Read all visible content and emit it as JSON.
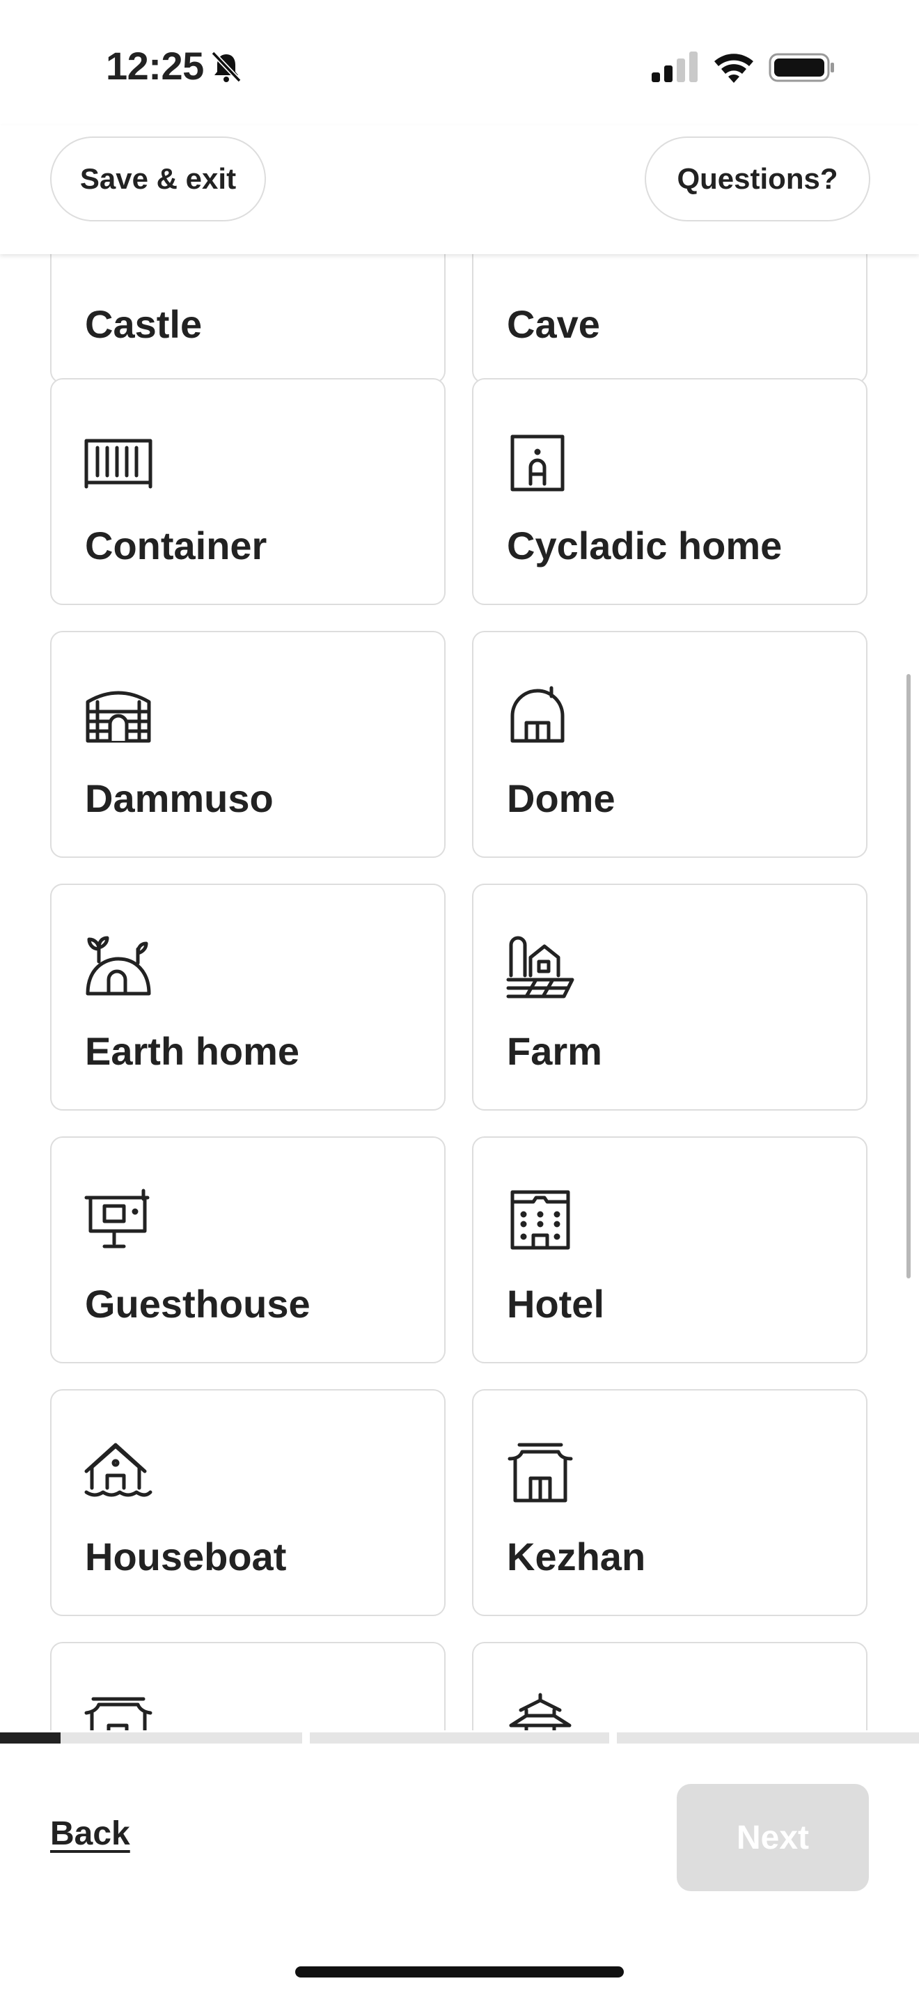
{
  "status_bar": {
    "time": "12:25"
  },
  "header": {
    "save_exit_label": "Save & exit",
    "questions_label": "Questions?"
  },
  "tiles": [
    {
      "label": "Castle",
      "icon": "castle-icon"
    },
    {
      "label": "Cave",
      "icon": "cave-icon"
    },
    {
      "label": "Container",
      "icon": "container-icon"
    },
    {
      "label": "Cycladic home",
      "icon": "cycladic-home-icon"
    },
    {
      "label": "Dammuso",
      "icon": "dammuso-icon"
    },
    {
      "label": "Dome",
      "icon": "dome-icon"
    },
    {
      "label": "Earth home",
      "icon": "earth-home-icon"
    },
    {
      "label": "Farm",
      "icon": "farm-icon"
    },
    {
      "label": "Guesthouse",
      "icon": "guesthouse-icon"
    },
    {
      "label": "Hotel",
      "icon": "hotel-icon"
    },
    {
      "label": "Houseboat",
      "icon": "houseboat-icon"
    },
    {
      "label": "Kezhan",
      "icon": "kezhan-icon"
    },
    {
      "label": "",
      "icon": "minsu-icon"
    },
    {
      "label": "",
      "icon": "pagoda-icon"
    }
  ],
  "progress": {
    "step_1_fraction": 0.2
  },
  "footer": {
    "back_label": "Back",
    "next_label": "Next"
  },
  "colors": {
    "text": "#222222",
    "border": "#dddddd",
    "disabled_button": "#dddddd",
    "progress_fill": "#222222"
  }
}
